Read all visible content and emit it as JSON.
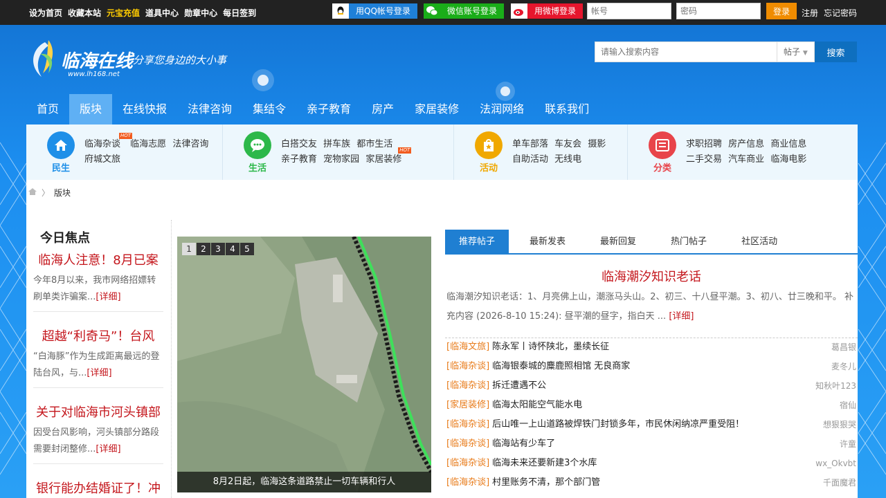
{
  "topbar": {
    "links": [
      "设为首页",
      "收藏本站",
      "元宝充值",
      "道具中心",
      "勋章中心",
      "每日签到"
    ],
    "qq_login": "用QQ帐号登录",
    "wechat_login": "微信账号登录",
    "weibo_login": "用微博登录",
    "account_placeholder": "帐号",
    "password_placeholder": "密码",
    "login_label": "登录",
    "register_label": "注册",
    "forgot_label": "忘记密码"
  },
  "header": {
    "site_name": "临海在线",
    "url": "www.lh168.net",
    "slogan": "分享您身边的大小事",
    "search_placeholder": "请输入搜索内容",
    "search_type": "帖子",
    "search_button": "搜索"
  },
  "nav": [
    "首页",
    "版块",
    "在线快报",
    "法律咨询",
    "集结令",
    "亲子教育",
    "房产",
    "家居装修",
    "法润网络",
    "联系我们"
  ],
  "nav_active_index": 1,
  "categories": [
    {
      "label": "民生",
      "color": "#1e8fe8",
      "icon": "home-icon",
      "links": [
        "临海杂谈",
        "临海志愿",
        "法律咨询",
        "府城文旅"
      ],
      "hot_index": 0
    },
    {
      "label": "生活",
      "color": "#2db84a",
      "icon": "chat-icon",
      "links": [
        "白搭交友",
        "拼车族",
        "都市生活",
        "亲子教育",
        "宠物家园",
        "家居装修"
      ],
      "hot_index": 2
    },
    {
      "label": "活动",
      "color": "#f0a800",
      "icon": "star-bag-icon",
      "links": [
        "单车部落",
        "车友会",
        "摄影",
        "自助活动",
        "无线电"
      ],
      "hot_index": -1
    },
    {
      "label": "分类",
      "color": "#e8444a",
      "icon": "list-icon",
      "links": [
        "求职招聘",
        "房产信息",
        "商业信息",
        "二手交易",
        "汽车商业",
        "临海电影"
      ],
      "hot_index": -1
    }
  ],
  "breadcrumb": {
    "current": "版块"
  },
  "focus": {
    "title": "今日焦点",
    "more_label": "[详细]",
    "items": [
      {
        "title": "临海人注意！8月已案",
        "desc": "今年8月以来，我市网络招嫖转刷单类诈骗案..."
      },
      {
        "title": "超越“利奇马”！台风",
        "desc": "“白海豚”作为生成距离最远的登陆台风，与..."
      },
      {
        "title": "关于对临海市河头镇部",
        "desc": "因受台风影响，河头镇部分路段需要封闭整修..."
      },
      {
        "title": "银行能办结婚证了！冲",
        "desc": ""
      }
    ]
  },
  "slider": {
    "pages": [
      "1",
      "2",
      "3",
      "4",
      "5"
    ],
    "active_page": 0,
    "caption": "8月2日起，临海这条道路禁止一切车辆和行人"
  },
  "tabs": [
    "推荐帖子",
    "最新发表",
    "最新回复",
    "热门帖子",
    "社区活动"
  ],
  "active_tab": 0,
  "recommend": {
    "title": "临海潮汐知识老话",
    "desc": "临海潮汐知识老话：1、月亮佛上山，潮涨马头山。2、初三、十八昼平潮。3、初八、廿三晚和平。 补充内容 (2026-8-10 15:24): 昼平潮的昼字，指白天 ...",
    "more_label": "[详细]"
  },
  "posts": [
    {
      "cat": "[临海文旅]",
      "title": "陈永军丨诗怀陕北，墨续长征",
      "author": "葛昌银"
    },
    {
      "cat": "[临海杂谈]",
      "title": "临海银泰城的麋鹿照相馆 无良商家",
      "author": "麦冬儿"
    },
    {
      "cat": "[临海杂谈]",
      "title": "拆迁遭遇不公",
      "author": "知秋叶123"
    },
    {
      "cat": "[家居装修]",
      "title": "临海太阳能空气能水电",
      "author": "宿仙"
    },
    {
      "cat": "[临海杂谈]",
      "title": "后山唯一上山道路被焊铁门封锁多年，市民休闲纳凉严重受阻！",
      "author": "想狠狠哭"
    },
    {
      "cat": "[临海杂谈]",
      "title": "临海站有少车了",
      "author": "许童"
    },
    {
      "cat": "[临海杂谈]",
      "title": "临海未来还要新建3个水库",
      "author": "wx_Okvbt"
    },
    {
      "cat": "[临海杂谈]",
      "title": "村里账务不清，那个部门管",
      "author": "千面魔君"
    }
  ]
}
